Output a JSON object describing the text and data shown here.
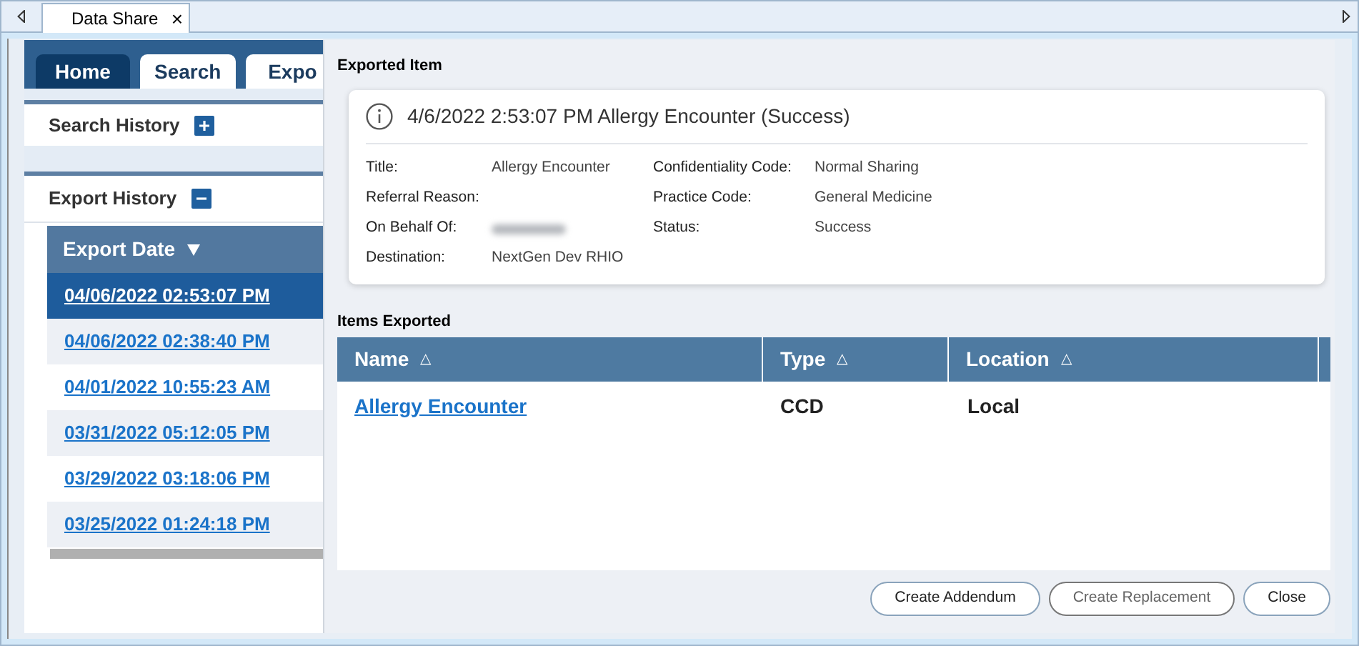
{
  "window_tab": {
    "label": "Data Share",
    "close": "×"
  },
  "nav_tabs": [
    {
      "label": "Home",
      "selected": true
    },
    {
      "label": "Search",
      "selected": false
    },
    {
      "label": "Expo",
      "selected": false
    }
  ],
  "search_history": {
    "title": "Search History",
    "expanded": false
  },
  "export_history": {
    "title": "Export History",
    "expanded": true,
    "column": "Export Date",
    "rows": [
      {
        "date": "04/06/2022 02:53:07 PM",
        "selected": true
      },
      {
        "date": "04/06/2022 02:38:40 PM",
        "selected": false
      },
      {
        "date": "04/01/2022 10:55:23 AM",
        "selected": false
      },
      {
        "date": "03/31/2022 05:12:05 PM",
        "selected": false
      },
      {
        "date": "03/29/2022 03:18:06 PM",
        "selected": false
      },
      {
        "date": "03/25/2022 01:24:18 PM",
        "selected": false
      }
    ]
  },
  "exported_item": {
    "heading": "Exported Item",
    "title": "4/6/2022 2:53:07 PM Allergy Encounter (Success)",
    "fields_left": [
      {
        "label": "Title:",
        "value": "Allergy Encounter"
      },
      {
        "label": "Referral Reason:"
      },
      {
        "label": "On Behalf Of:",
        "redacted": true
      },
      {
        "label": "Destination:",
        "value": "NextGen Dev RHIO"
      }
    ],
    "fields_right": [
      {
        "label": "Confidentiality Code:",
        "value": "Normal Sharing"
      },
      {
        "label": "Practice Code:",
        "value": "General Medicine"
      },
      {
        "label": "Status:",
        "value": "Success"
      }
    ]
  },
  "items_exported": {
    "heading": "Items Exported",
    "columns": [
      {
        "label": "Name",
        "sort": "△"
      },
      {
        "label": "Type",
        "sort": "△"
      },
      {
        "label": "Location",
        "sort": "△"
      }
    ],
    "rows": [
      {
        "name": "Allergy Encounter",
        "type": "CCD",
        "location": "Local"
      }
    ]
  },
  "buttons": [
    {
      "label": "Create Addendum",
      "disabled": false
    },
    {
      "label": "Create Replacement",
      "disabled": true
    },
    {
      "label": "Close",
      "disabled": false
    }
  ]
}
